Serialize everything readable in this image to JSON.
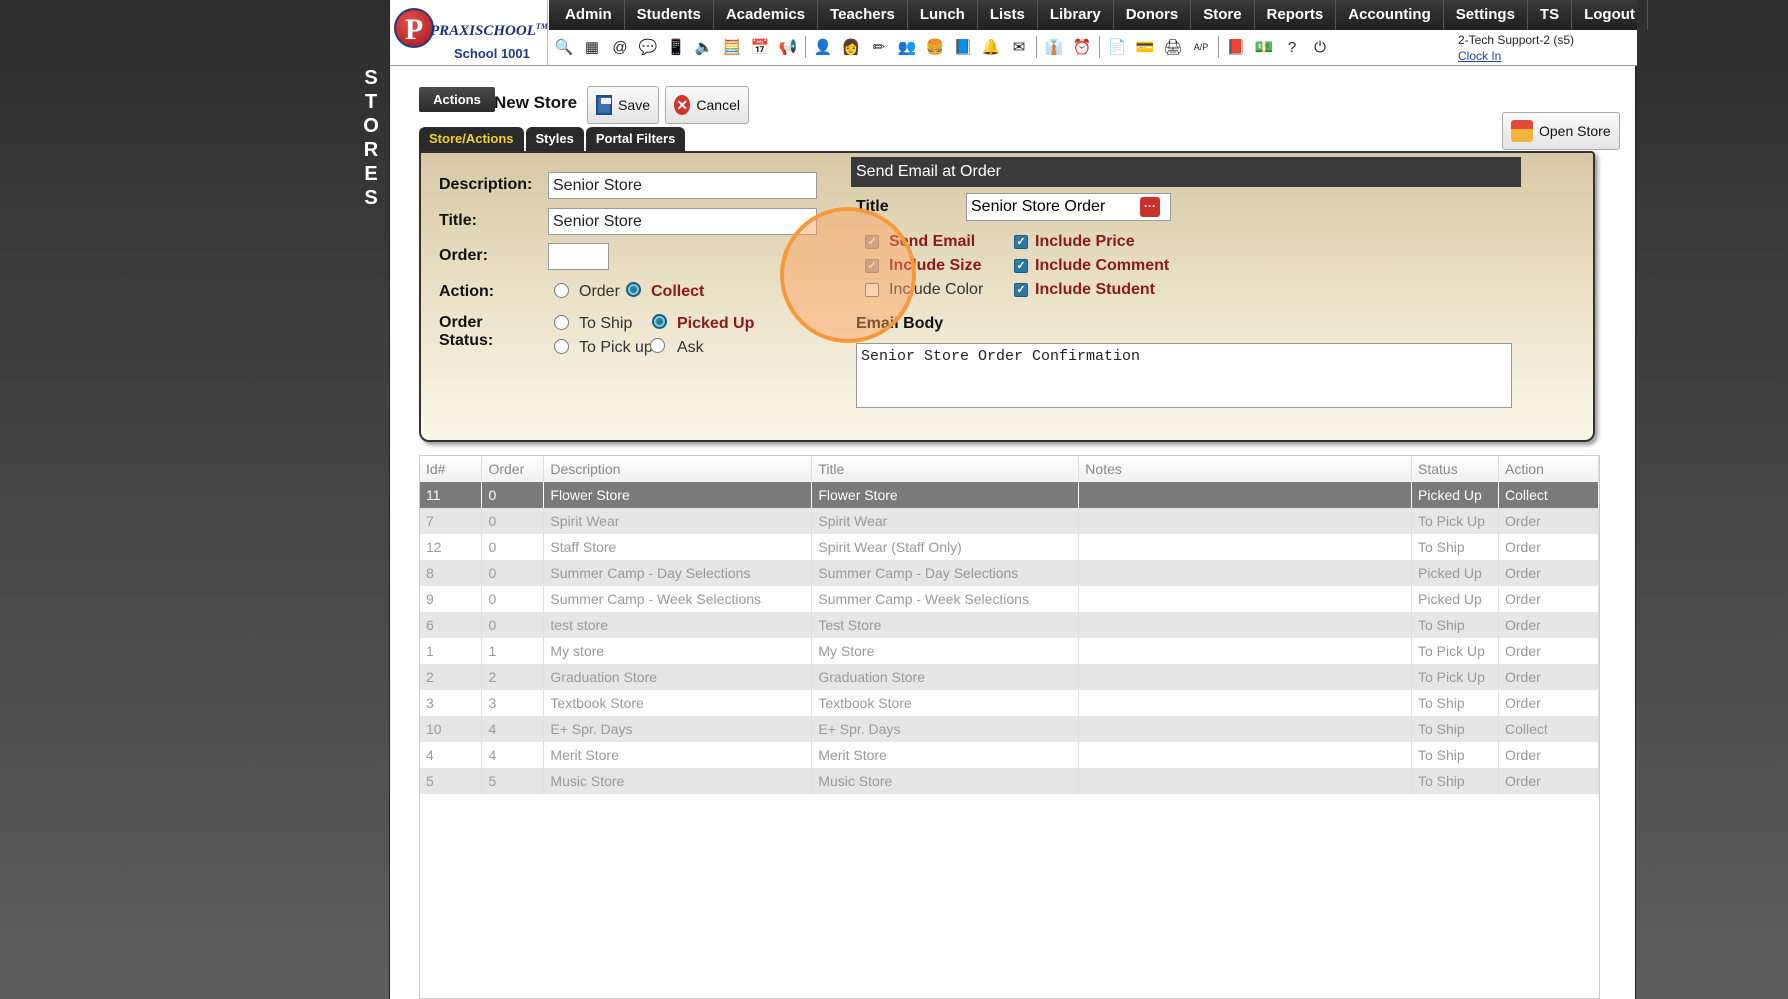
{
  "side_label": [
    "S",
    "T",
    "O",
    "R",
    "E",
    "S"
  ],
  "logo": {
    "brand_p": "P",
    "brand": "PRAXISCHOOL",
    "tm": "TM",
    "school": "School 1001"
  },
  "nav": [
    "Admin",
    "Students",
    "Academics",
    "Teachers",
    "Lunch",
    "Lists",
    "Library",
    "Donors",
    "Store",
    "Reports",
    "Accounting",
    "Settings",
    "TS",
    "Logout"
  ],
  "toolbar_icons": [
    {
      "name": "search-icon",
      "glyph": "🔍"
    },
    {
      "name": "grid-icon",
      "glyph": "▦"
    },
    {
      "name": "email-icon",
      "glyph": "@"
    },
    {
      "name": "chat-icon",
      "glyph": "💬"
    },
    {
      "name": "phone-icon",
      "glyph": "📱"
    },
    {
      "name": "speaker-icon",
      "glyph": "🔈"
    },
    {
      "name": "calculator-icon",
      "glyph": "🧮"
    },
    {
      "name": "calendar-icon",
      "glyph": "📅"
    },
    {
      "name": "megaphone-icon",
      "glyph": "📢"
    },
    {
      "name": "sep"
    },
    {
      "name": "person-icon",
      "glyph": "👤"
    },
    {
      "name": "teacher-icon",
      "glyph": "👩"
    },
    {
      "name": "pencil-icon",
      "glyph": "✏"
    },
    {
      "name": "group-icon",
      "glyph": "👥"
    },
    {
      "name": "lunch-icon",
      "glyph": "🍔"
    },
    {
      "name": "book-icon",
      "glyph": "📘"
    },
    {
      "name": "bell-icon",
      "glyph": "🔔"
    },
    {
      "name": "mail-icon",
      "glyph": "✉"
    },
    {
      "name": "sep"
    },
    {
      "name": "staff-icon",
      "glyph": "👔"
    },
    {
      "name": "clock-icon",
      "glyph": "⏰"
    },
    {
      "name": "sep"
    },
    {
      "name": "report-icon",
      "glyph": "📄"
    },
    {
      "name": "card-icon",
      "glyph": "💳"
    },
    {
      "name": "register-icon",
      "glyph": "🖨"
    },
    {
      "name": "ap-icon",
      "glyph": "A/P"
    },
    {
      "name": "sep"
    },
    {
      "name": "pdf-icon",
      "glyph": "📕"
    },
    {
      "name": "money-icon",
      "glyph": "💵"
    },
    {
      "name": "help-icon",
      "glyph": "?"
    },
    {
      "name": "power-icon",
      "glyph": "⏻"
    }
  ],
  "user": {
    "name": "2-Tech Support-2 (s5)",
    "clock_in": "Clock In"
  },
  "actions": {
    "actions_label": "Actions",
    "title": "New Store",
    "save": "Save",
    "cancel": "Cancel",
    "open_store": "Open Store"
  },
  "tabs": [
    "Store/Actions",
    "Styles",
    "Portal Filters"
  ],
  "form": {
    "description_label": "Description:",
    "description": "Senior Store",
    "title_label": "Title:",
    "title": "Senior Store",
    "order_label": "Order:",
    "order": "",
    "action_label": "Action:",
    "action_order": "Order",
    "action_collect": "Collect",
    "status_label_1": "Order",
    "status_label_2": "Status:",
    "to_ship": "To Ship",
    "picked_up": "Picked Up",
    "to_pick_up": "To Pick up",
    "ask": "Ask"
  },
  "email": {
    "header": "Send Email at Order",
    "title_label": "Title",
    "title": "Senior Store Order",
    "send_email": "Send Email",
    "include_size": "Include Size",
    "include_color": "Include Color",
    "include_price": "Include Price",
    "include_comment": "Include Comment",
    "include_student": "Include Student",
    "body_label": "Email Body",
    "body": "Senior Store Order Confirmation"
  },
  "table": {
    "columns": [
      "Id#",
      "Order",
      "Description",
      "Title",
      "Notes",
      "Status",
      "Action"
    ],
    "rows": [
      [
        "11",
        "0",
        "Flower Store",
        "Flower Store",
        "",
        "Picked Up",
        "Collect"
      ],
      [
        "7",
        "0",
        "Spirit Wear",
        "Spirit Wear",
        "",
        "To Pick Up",
        "Order"
      ],
      [
        "12",
        "0",
        "Staff Store",
        "Spirit Wear (Staff Only)",
        "",
        "To Ship",
        "Order"
      ],
      [
        "8",
        "0",
        "Summer Camp - Day Selections",
        "Summer Camp - Day Selections",
        "",
        "Picked Up",
        "Order"
      ],
      [
        "9",
        "0",
        "Summer Camp - Week Selections",
        "Summer Camp - Week Selections",
        "",
        "Picked Up",
        "Order"
      ],
      [
        "6",
        "0",
        "test store",
        "Test Store",
        "",
        "To Ship",
        "Order"
      ],
      [
        "1",
        "1",
        "My store",
        "My Store",
        "",
        "To Pick Up",
        "Order"
      ],
      [
        "2",
        "2",
        "Graduation Store",
        "Graduation Store",
        "",
        "To Pick Up",
        "Order"
      ],
      [
        "3",
        "3",
        "Textbook Store",
        "Textbook Store",
        "",
        "To Ship",
        "Order"
      ],
      [
        "10",
        "4",
        "E+ Spr. Days",
        "E+ Spr. Days",
        "",
        "To Ship",
        "Collect"
      ],
      [
        "4",
        "4",
        "Merit Store",
        "Merit Store",
        "",
        "To Ship",
        "Order"
      ],
      [
        "5",
        "5",
        "Music Store",
        "Music Store",
        "",
        "To Ship",
        "Order"
      ]
    ]
  }
}
